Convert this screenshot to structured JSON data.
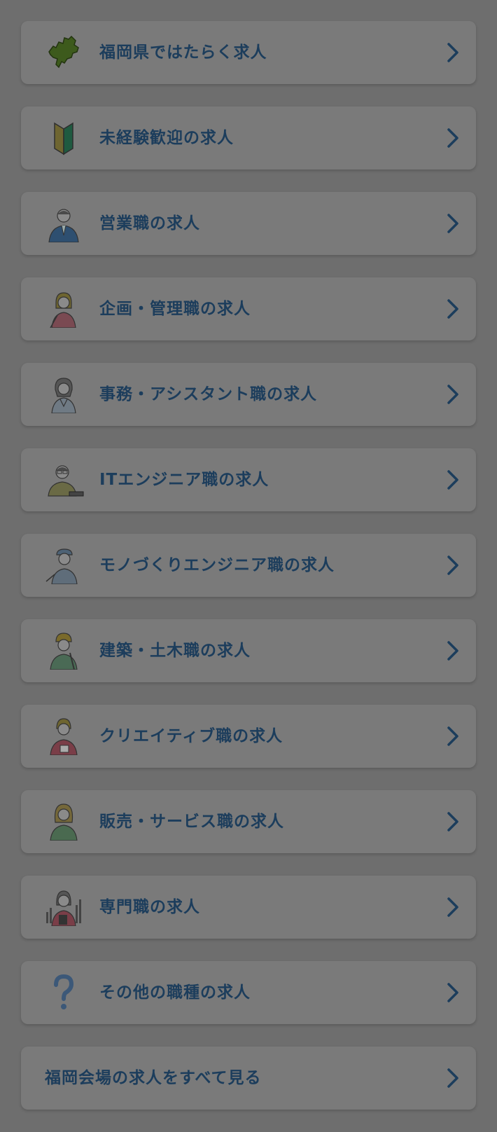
{
  "categories": [
    {
      "label": "福岡県ではたらく求人",
      "icon": "fukuoka-map-icon"
    },
    {
      "label": "未経験歓迎の求人",
      "icon": "beginner-mark-icon"
    },
    {
      "label": "営業職の求人",
      "icon": "salesman-icon"
    },
    {
      "label": "企画・管理職の求人",
      "icon": "planner-icon"
    },
    {
      "label": "事務・アシスタント職の求人",
      "icon": "office-worker-icon"
    },
    {
      "label": "ITエンジニア職の求人",
      "icon": "it-engineer-icon"
    },
    {
      "label": "モノづくりエンジニア職の求人",
      "icon": "factory-engineer-icon"
    },
    {
      "label": "建築・土木職の求人",
      "icon": "construction-worker-icon"
    },
    {
      "label": "クリエイティブ職の求人",
      "icon": "creative-worker-icon"
    },
    {
      "label": "販売・サービス職の求人",
      "icon": "service-staff-icon"
    },
    {
      "label": "専門職の求人",
      "icon": "specialist-icon"
    },
    {
      "label": "その他の職種の求人",
      "icon": "question-mark-icon"
    }
  ],
  "view_all": {
    "label": "福岡会場の求人をすべて見る"
  },
  "colors": {
    "overlay_background": "#6e6e6e",
    "card_background": "#7a7a7a",
    "label_text": "#1c3d5c",
    "chevron": "#1c3d5c"
  }
}
